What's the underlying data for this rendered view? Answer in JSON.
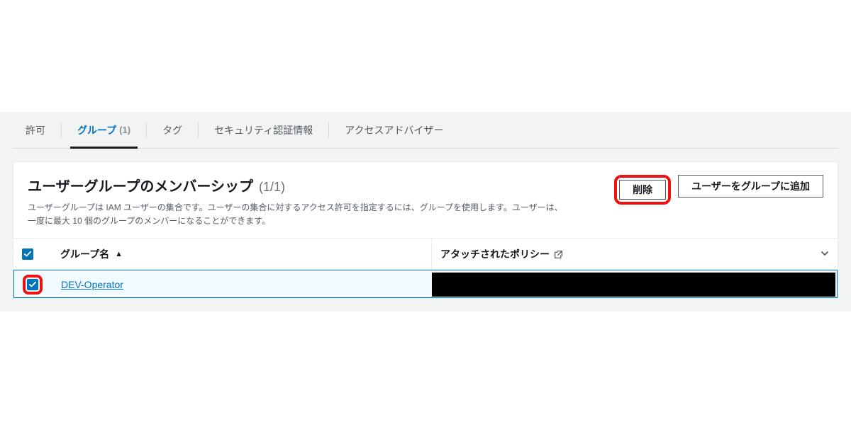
{
  "tabs": {
    "permissions": "許可",
    "groups": "グループ",
    "groups_count": "(1)",
    "tags": "タグ",
    "security": "セキュリティ認証情報",
    "advisor": "アクセスアドバイザー"
  },
  "section": {
    "title": "ユーザーグループのメンバーシップ",
    "count": "(1/1)",
    "subtitle": "ユーザーグループは IAM ユーザーの集合です。ユーザーの集合に対するアクセス許可を指定するには、グループを使用します。ユーザーは、一度に最大 10 個のグループのメンバーになることができます。"
  },
  "actions": {
    "delete": "削除",
    "add": "ユーザーをグループに追加"
  },
  "table": {
    "col_group": "グループ名",
    "col_policies": "アタッチされたポリシー",
    "rows": [
      {
        "name": "DEV-Operator"
      }
    ]
  }
}
